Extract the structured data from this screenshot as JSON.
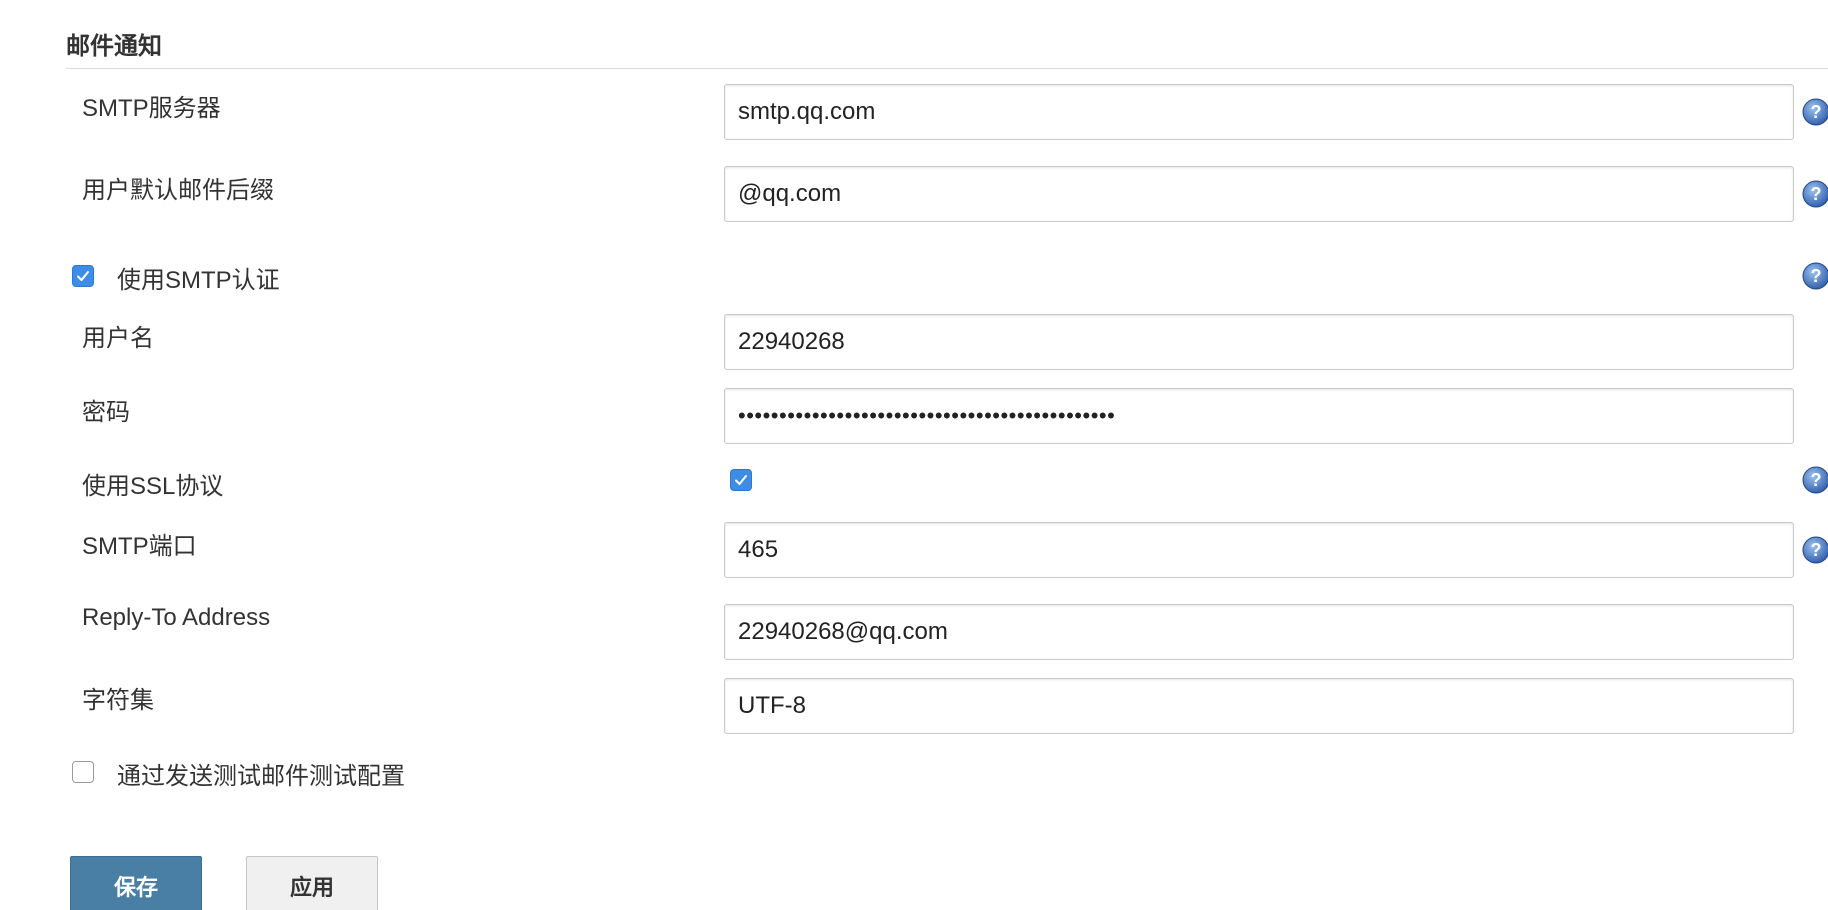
{
  "section": {
    "title": "邮件通知"
  },
  "fields": {
    "smtp_server": {
      "label": "SMTP服务器",
      "value": "smtp.qq.com"
    },
    "default_suffix": {
      "label": "用户默认邮件后缀",
      "value": "@qq.com"
    },
    "use_smtp_auth": {
      "label": "使用SMTP认证",
      "checked": true
    },
    "username": {
      "label": "用户名",
      "value": "22940268"
    },
    "password": {
      "label": "密码",
      "value": "••••••••••••••••••••••••••••••••••••••••••••••"
    },
    "use_ssl": {
      "label": "使用SSL协议",
      "checked": true
    },
    "smtp_port": {
      "label": "SMTP端口",
      "value": "465"
    },
    "reply_to": {
      "label": "Reply-To Address",
      "value": "22940268@qq.com"
    },
    "charset": {
      "label": "字符集",
      "value": "UTF-8"
    },
    "test_config": {
      "label": "通过发送测试邮件测试配置",
      "checked": false
    }
  },
  "buttons": {
    "save": "保存",
    "apply": "应用"
  },
  "colors": {
    "checkbox_checked": "#3d8ce6",
    "primary_button": "#4a7fa5",
    "help_icon": "#2c5aa8"
  },
  "icons": {
    "help": "help-icon",
    "check": "check-icon"
  }
}
